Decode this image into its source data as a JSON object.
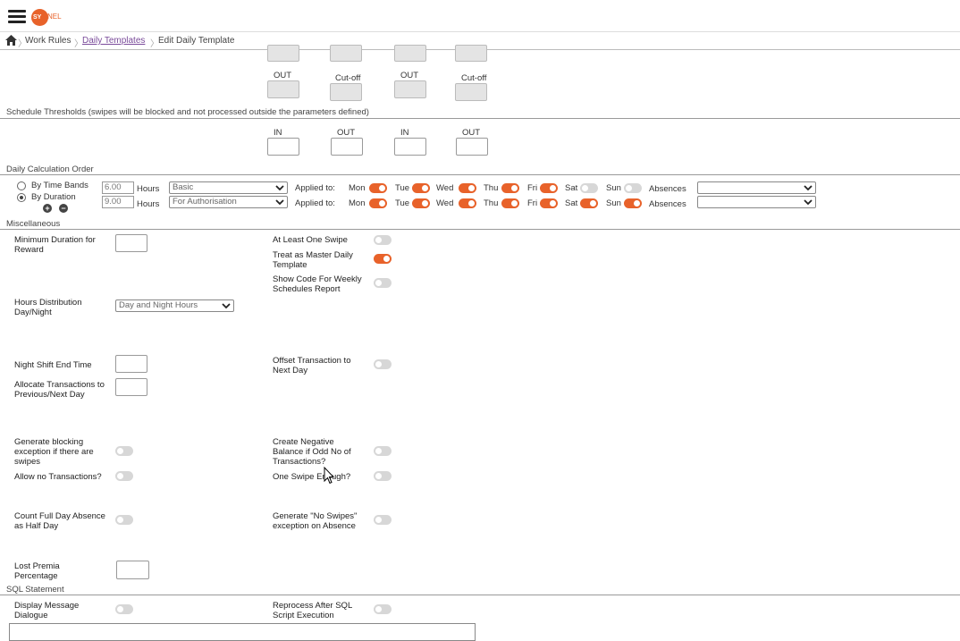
{
  "header": {
    "logo_text": "SY",
    "logo_rest": "NEL"
  },
  "breadcrumb": {
    "item1": "Work Rules",
    "item2": "Daily Templates",
    "item3": "Edit Daily Template",
    "sep": "〉"
  },
  "labels": {
    "out": "OUT",
    "cutoff": "Cut-off",
    "in": "IN"
  },
  "sections": {
    "thresholds": "Schedule Thresholds (swipes will be blocked and not processed outside the parameters defined)",
    "calc_order": "Daily Calculation Order",
    "misc": "Miscellaneous",
    "sql": "SQL Statement"
  },
  "calc": {
    "by_time_bands": "By Time Bands",
    "by_duration": "By Duration",
    "hours_label": "Hours",
    "row1": {
      "hours": "6.00",
      "type": "Basic"
    },
    "row2": {
      "hours": "9.00",
      "type": "For Authorisation"
    },
    "applied_to": "Applied to:",
    "days": [
      "Mon",
      "Tue",
      "Wed",
      "Thu",
      "Fri",
      "Sat",
      "Sun"
    ],
    "absences": "Absences",
    "row1_days_on": [
      true,
      true,
      true,
      true,
      true,
      false,
      false
    ],
    "row2_days_on": [
      true,
      true,
      true,
      true,
      true,
      true,
      true
    ]
  },
  "misc": {
    "min_duration": "Minimum Duration for Reward",
    "at_least_one_swipe": "At Least One Swipe",
    "treat_master": "Treat as Master Daily Template",
    "show_code": "Show Code For Weekly Schedules Report",
    "hours_distribution": "Hours Distribution Day/Night",
    "hours_distribution_value": "Day and Night Hours",
    "night_shift_end": "Night Shift End Time",
    "offset_transaction": "Offset Transaction to Next Day",
    "allocate_transactions": "Allocate Transactions to Previous/Next Day",
    "generate_blocking": "Generate blocking exception if there are swipes",
    "create_negative": "Create Negative Balance if Odd No of Transactions?",
    "allow_no_transactions": "Allow no Transactions?",
    "one_swipe_enough": "One Swipe Enough?",
    "count_full_day": "Count Full Day Absence as Half Day",
    "generate_no_swipes": "Generate \"No Swipes\" exception on Absence",
    "lost_premia": "Lost Premia Percentage"
  },
  "sql": {
    "display_message": "Display Message Dialogue",
    "reprocess_after": "Reprocess After SQL Script Execution"
  },
  "colors": {
    "accent": "#e8622a",
    "toggle_off": "#d7d7d7"
  }
}
